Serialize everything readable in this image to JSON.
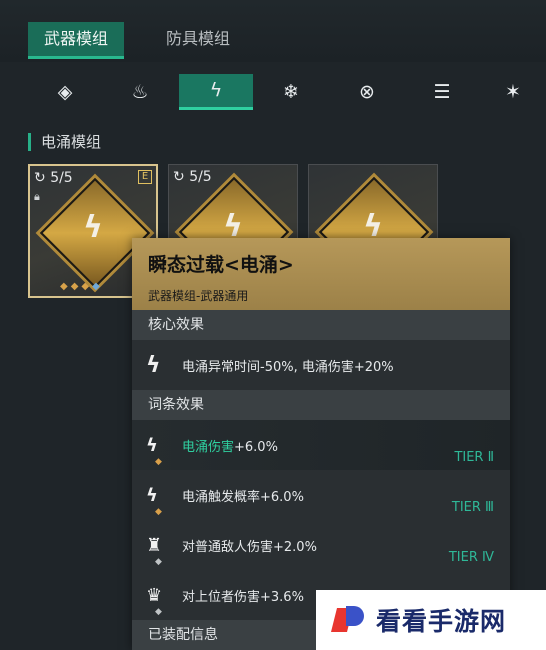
{
  "top_tabs": [
    "武器模组",
    "防具模组"
  ],
  "element_tabs": [
    {
      "icon": "◈",
      "name": "diamond-element-icon"
    },
    {
      "icon": "♨",
      "name": "fire-element-icon"
    },
    {
      "icon": "ϟ",
      "name": "electric-element-icon",
      "active": true
    },
    {
      "icon": "❄",
      "name": "ice-element-icon"
    },
    {
      "icon": "⊗",
      "name": "void-element-icon"
    },
    {
      "icon": "☰",
      "name": "physical-element-icon"
    },
    {
      "icon": "✶",
      "name": "burst-element-icon"
    }
  ],
  "section_label": "电涌模组",
  "cards": [
    {
      "count": "5/5",
      "rarity": "E",
      "glyph": "ϟ"
    },
    {
      "count": "5/5",
      "glyph": "ϟ"
    },
    {
      "count": "",
      "glyph": "ϟ"
    }
  ],
  "tooltip": {
    "title": "瞬态过载<电涌>",
    "subtitle": "武器模组-武器通用",
    "core_header": "核心效果",
    "core_text": "电涌异常时间-50%, 电涌伤害+20%",
    "affix_header": "词条效果",
    "affixes": [
      {
        "prefix": "电涌伤害",
        "suffix": "+6.0%",
        "tier": "TIER Ⅱ"
      },
      {
        "prefix": "",
        "suffix": "电涌触发概率+6.0%",
        "tier": "TIER Ⅲ"
      },
      {
        "prefix": "",
        "suffix": "对普通敌人伤害+2.0%",
        "tier": "TIER Ⅳ"
      },
      {
        "prefix": "",
        "suffix": "对上位者伤害+3.6%",
        "tier": ""
      }
    ],
    "equipped_header": "已装配信息"
  },
  "watermark": {
    "text": "看看手游网"
  }
}
